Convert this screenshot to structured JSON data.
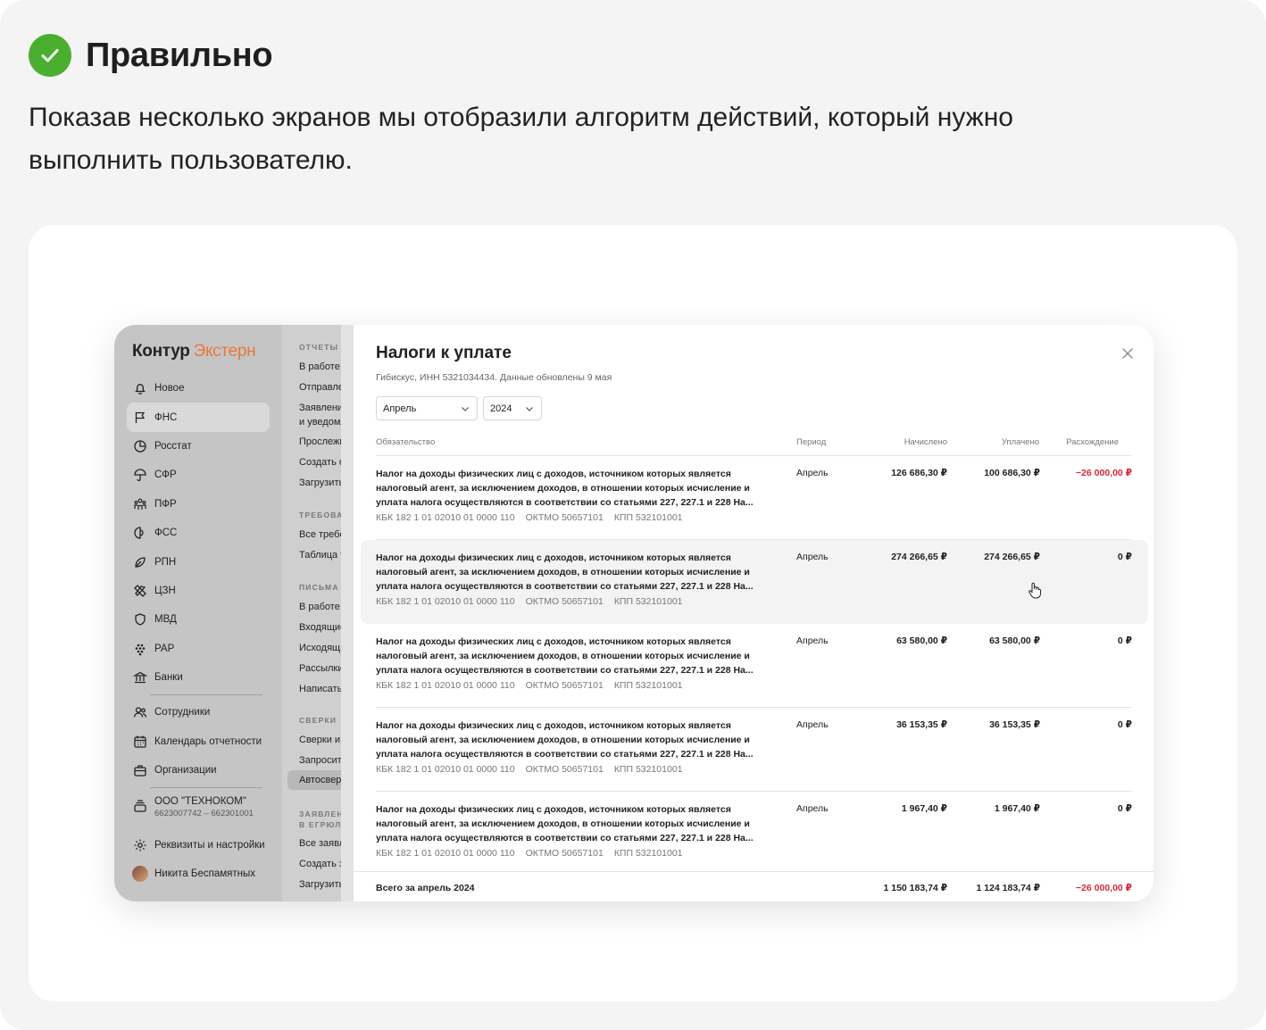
{
  "header": {
    "title": "Правильно",
    "description": "Показав несколько экранов мы отобразили алгоритм действий, который нужно выполнить пользователю.",
    "check_color": "#4aaf2f"
  },
  "app": {
    "logo_part1": "Контур",
    "logo_part2": "Экстерн",
    "brand_color": "#e8783c",
    "nav": [
      {
        "label": "Новое",
        "icon": "bell-icon"
      },
      {
        "label": "ФНС",
        "icon": "flag-icon",
        "active": true
      },
      {
        "label": "Росстат",
        "icon": "pie-chart-icon"
      },
      {
        "label": "СФР",
        "icon": "umbrella-icon"
      },
      {
        "label": "ПФР",
        "icon": "people-icon"
      },
      {
        "label": "ФСС",
        "icon": "shield-half-icon"
      },
      {
        "label": "РПН",
        "icon": "leaf-icon"
      },
      {
        "label": "ЦЗН",
        "icon": "tools-icon"
      },
      {
        "label": "МВД",
        "icon": "shield-icon"
      },
      {
        "label": "РАР",
        "icon": "grapes-icon"
      },
      {
        "label": "Банки",
        "icon": "bank-icon"
      }
    ],
    "nav2": [
      {
        "label": "Сотрудники",
        "icon": "users-icon"
      },
      {
        "label": "Календарь отчетности",
        "icon": "calendar-icon"
      },
      {
        "label": "Организации",
        "icon": "briefcase-icon"
      }
    ],
    "org": {
      "name": "ООО \"ТЕХНОКОМ\"",
      "codes": "6623007742 – 662301001"
    },
    "settings_label": "Реквизиты и настройки",
    "user_name": "Никита Беспамятных",
    "submenu": {
      "s1": "ОТЧЕТЫ",
      "s1_items": [
        "В работе",
        "Отправленные",
        "Заявления",
        "и уведомления",
        "Прослеживаемость",
        "Создать отчет",
        "Загрузить отчет"
      ],
      "s2": "ТРЕБОВАНИЯ",
      "s2_items": [
        "Все требования",
        "Таблица требований"
      ],
      "s3": "ПИСЬМА",
      "s3_items": [
        "В работе",
        "Входящие",
        "Исходящие",
        "Рассылки",
        "Написать письмо"
      ],
      "s4": "СВЕРКИ",
      "s4_items": [
        "Сверки и выписки",
        "Запросить сверку",
        "Автосверка"
      ],
      "s5a": "ЗАЯВЛЕНИЯ",
      "s5b": "В ЕГРЮЛ/ЕГРИП",
      "s5_items": [
        "Все заявления",
        "Создать заявление",
        "Загрузить заявление"
      ]
    },
    "panel": {
      "title": "Налоги к уплате",
      "subtitle": "Гибискус, ИНН 5321034434. Данные обновлены 9 мая",
      "month": "Апрель",
      "year": "2024",
      "columns": [
        "Обязательство",
        "Период",
        "Начислено",
        "Уплачено",
        "Расхождение"
      ],
      "rows": [
        {
          "line1": "Налог на доходы физических лиц с доходов, источником которых является",
          "line2": "налоговый агент, за исключением доходов, в отношении которых исчисление и",
          "line3": "уплата налога осуществляются в соответствии со статьями 227, 227.1 и 228 На...",
          "kbk": "КБК 182 1 01 02010 01 0000 110",
          "oktmo": "ОКТМО 50657101",
          "kpp": "КПП 532101001",
          "period": "Апрель",
          "accrued": "126 686,30 ₽",
          "paid": "100 686,30 ₽",
          "diff": "−26 000,00 ₽",
          "negative": true
        },
        {
          "line1": "Налог на доходы физических лиц с доходов, источником которых является",
          "line2": "налоговый агент, за исключением доходов, в отношении которых исчисление и",
          "line3": "уплата налога осуществляются в соответствии со статьями 227, 227.1 и 228 На...",
          "kbk": "КБК 182 1 01 02010 01 0000 110",
          "oktmo": "ОКТМО 50657101",
          "kpp": "КПП 532101001",
          "period": "Апрель",
          "accrued": "274 266,65 ₽",
          "paid": "274 266,65 ₽",
          "diff": "0 ₽"
        },
        {
          "line1": "Налог на доходы физических лиц с доходов, источником которых является",
          "line2": "налоговый агент, за исключением доходов, в отношении которых исчисление и",
          "line3": "уплата налога осуществляются в соответствии со статьями 227, 227.1 и 228 На...",
          "kbk": "КБК 182 1 01 02010 01 0000 110",
          "oktmo": "ОКТМО 50657101",
          "kpp": "КПП 532101001",
          "period": "Апрель",
          "accrued": "63 580,00 ₽",
          "paid": "63 580,00 ₽",
          "diff": "0 ₽"
        },
        {
          "line1": "Налог на доходы физических лиц с доходов, источником которых является",
          "line2": "налоговый агент, за исключением доходов, в отношении которых исчисление и",
          "line3": "уплата налога осуществляются в соответствии со статьями 227, 227.1 и 228 На...",
          "kbk": "КБК 182 1 01 02010 01 0000 110",
          "oktmo": "ОКТМО 50657101",
          "kpp": "КПП 532101001",
          "period": "Апрель",
          "accrued": "36 153,35 ₽",
          "paid": "36 153,35 ₽",
          "diff": "0 ₽"
        },
        {
          "line1": "Налог на доходы физических лиц с доходов, источником которых является",
          "line2": "налоговый агент, за исключением доходов, в отношении которых исчисление и",
          "line3": "уплата налога осуществляются в соответствии со статьями 227, 227.1 и 228 На...",
          "kbk": "КБК 182 1 01 02010 01 0000 110",
          "oktmo": "ОКТМО 50657101",
          "kpp": "КПП 532101001",
          "period": "Апрель",
          "accrued": "1 967,40 ₽",
          "paid": "1 967,40 ₽",
          "diff": "0 ₽"
        }
      ],
      "total": {
        "label": "Всего за апрель 2024",
        "accrued": "1 150 183,74 ₽",
        "paid": "1 124 183,74 ₽",
        "diff": "−26 000,00 ₽"
      },
      "negative_color": "#d9263a"
    }
  }
}
